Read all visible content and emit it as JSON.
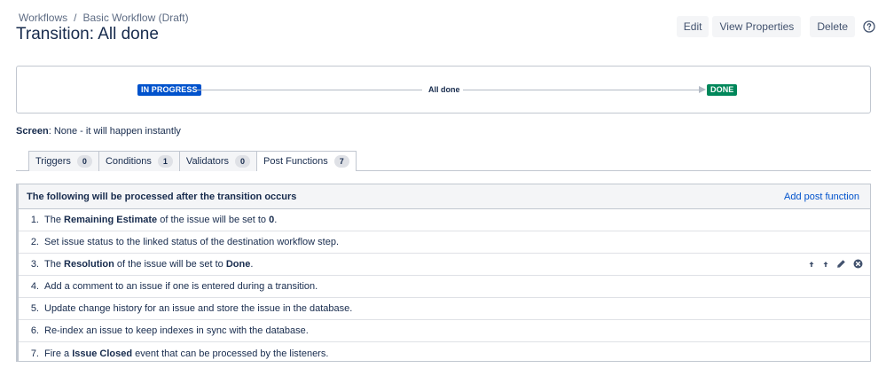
{
  "breadcrumb": {
    "workflows": "Workflows",
    "separator": "/",
    "workflow": "Basic Workflow (Draft)"
  },
  "page_title": "Transition: All done",
  "actions": {
    "edit": "Edit",
    "view_properties": "View Properties",
    "delete": "Delete",
    "help_icon": "question-circle-icon"
  },
  "diagram": {
    "from_status": "IN PROGRESS",
    "transition": "All done",
    "to_status": "DONE",
    "from_color": "#0052cc",
    "to_color": "#00875a"
  },
  "screen": {
    "label": "Screen",
    "value": ": None - it will happen instantly"
  },
  "tabs": [
    {
      "label": "Triggers",
      "count": "0"
    },
    {
      "label": "Conditions",
      "count": "1"
    },
    {
      "label": "Validators",
      "count": "0"
    },
    {
      "label": "Post Functions",
      "count": "7"
    }
  ],
  "active_tab": "Post Functions",
  "post_functions": {
    "header": "The following will be processed after the transition occurs",
    "add_label": "Add post function",
    "items": [
      {
        "num": "1.",
        "parts": [
          "The ",
          "Remaining Estimate",
          " of the issue will be set to ",
          "0",
          "."
        ]
      },
      {
        "num": "2.",
        "parts": [
          "Set issue status to the linked status of the destination workflow step."
        ]
      },
      {
        "num": "3.",
        "parts": [
          "The ",
          "Resolution",
          " of the issue will be set to ",
          "Done",
          "."
        ]
      },
      {
        "num": "4.",
        "parts": [
          "Add a comment to an issue if one is entered during a transition."
        ]
      },
      {
        "num": "5.",
        "parts": [
          "Update change history for an issue and store the issue in the database."
        ]
      },
      {
        "num": "6.",
        "parts": [
          "Re-index an issue to keep indexes in sync with the database."
        ]
      },
      {
        "num": "7.",
        "parts": [
          "Fire a ",
          "Issue Closed",
          " event that can be processed by the listeners."
        ]
      }
    ],
    "row_action_icons": [
      "move-up-icon",
      "move-down-icon",
      "edit-pencil-icon",
      "delete-icon"
    ]
  },
  "colors": {
    "link": "#0052cc",
    "text": "#172b4d",
    "border": "#c1c7d0"
  }
}
